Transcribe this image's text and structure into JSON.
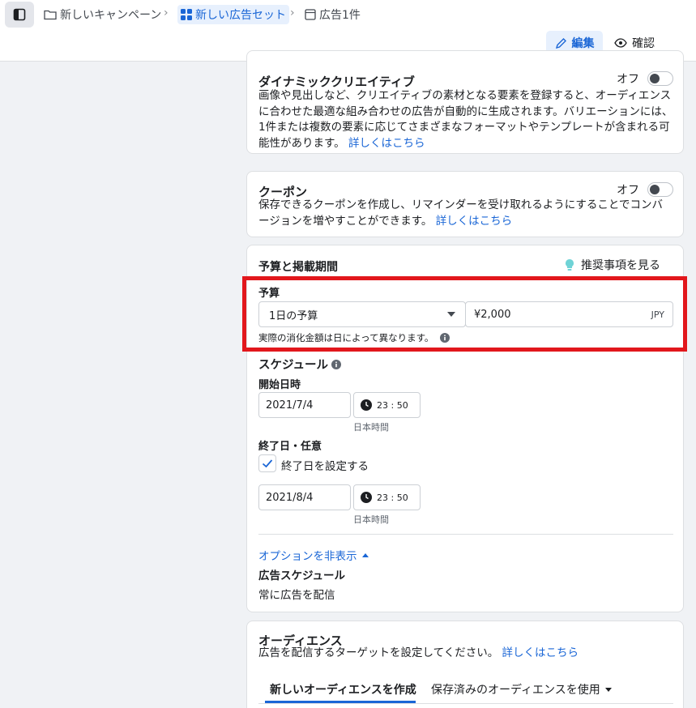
{
  "breadcrumb": {
    "campaign": "新しいキャンペーン",
    "adset": "新しい広告セット",
    "ad": "広告1件"
  },
  "header": {
    "edit_label": "編集",
    "review_label": "確認"
  },
  "dynamic_creative": {
    "title": "ダイナミッククリエイティブ",
    "toggle_label": "オフ",
    "description": "画像や見出しなど、クリエイティブの素材となる要素を登録すると、オーディエンスに合わせた最適な組み合わせの広告が自動的に生成されます。バリエーションには、1件または複数の要素に応じてさまざまなフォーマットやテンプレートが含まれる可能性があります。",
    "learn_more": "詳しくはこちら"
  },
  "coupon": {
    "title": "クーポン",
    "toggle_label": "オフ",
    "description": "保存できるクーポンを作成し、リマインダーを受け取れるようにすることでコンバージョンを増やすことができます。",
    "learn_more": "詳しくはこちら"
  },
  "budget_schedule": {
    "title": "予算と掲載期間",
    "recommendations": "推奨事項を見る",
    "budget_label": "予算",
    "budget_type": "1日の予算",
    "budget_amount": "¥2,000",
    "currency": "JPY",
    "budget_note": "実際の消化金額は日によって異なります。",
    "schedule_label": "スケジュール",
    "start_label": "開始日時",
    "start_date": "2021/7/4",
    "start_time": "23 : 50",
    "start_tz": "日本時間",
    "end_label": "終了日・任意",
    "end_checkbox_label": "終了日を設定する",
    "end_date": "2021/8/4",
    "end_time": "23 : 50",
    "end_tz": "日本時間",
    "options_toggle": "オプションを非表示",
    "ad_schedule_label": "広告スケジュール",
    "ad_schedule_value": "常に広告を配信"
  },
  "audience": {
    "title": "オーディエンス",
    "description": "広告を配信するターゲットを設定してください。",
    "learn_more": "詳しくはこちら",
    "tab_new": "新しいオーディエンスを作成",
    "tab_saved": "保存済みのオーディエンスを使用"
  }
}
